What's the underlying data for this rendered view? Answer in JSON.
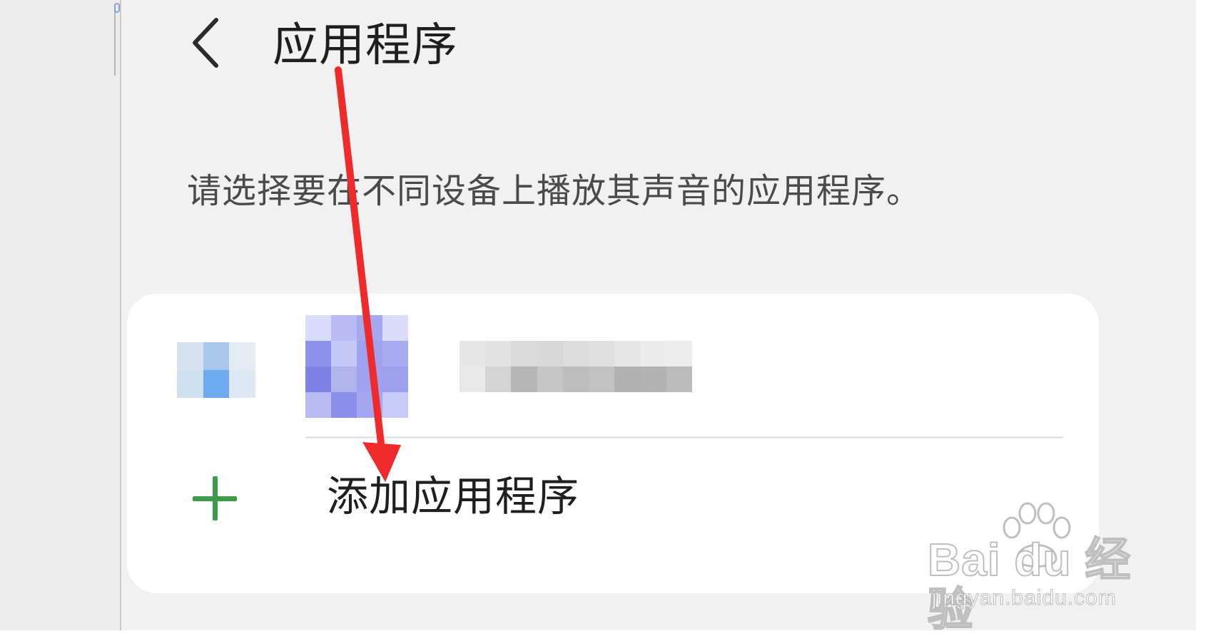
{
  "header": {
    "title": "应用程序",
    "back_icon": "chevron-left-icon"
  },
  "description": "请选择要在不同设备上播放其声音的应用程序。",
  "app_list": {
    "items": [
      {
        "name_obscured": true,
        "icon_obscured": true
      }
    ],
    "add_action": {
      "label": "添加应用程序",
      "icon": "plus-icon",
      "icon_color": "#3d9a49"
    }
  },
  "annotation": {
    "type": "arrow",
    "color": "#ee2a2a"
  },
  "watermark": {
    "brand": "Bai du 经验",
    "url": "jingyan.baidu.com"
  },
  "colors": {
    "background": "#f1f1f1",
    "card": "#ffffff",
    "accent_green": "#3d9a49",
    "arrow_red": "#ee2a2a"
  }
}
